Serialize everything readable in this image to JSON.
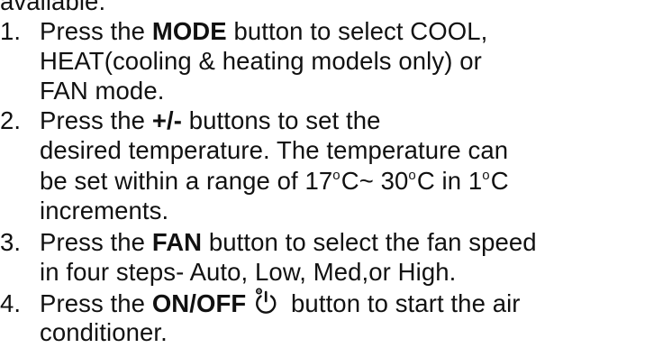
{
  "doc": {
    "top_fragment": "available:",
    "steps": [
      {
        "number": "1.",
        "lines": [
          {
            "before": "Press the ",
            "bold": "MODE",
            "after": " button to select COOL,"
          },
          {
            "text": "HEAT(cooling & heating models only) or"
          },
          {
            "text": "FAN mode."
          }
        ]
      },
      {
        "number": "2.",
        "lines": [
          {
            "before": "Press  the ",
            "bold": "+/-",
            "after": " buttons to set the"
          },
          {
            "text": "desired temperature. The temperature can"
          },
          {
            "t1": "be set within a range of 17",
            "deg": "o",
            "t2": "C~ 30",
            "t3": "C in 1",
            "t4": "C"
          },
          {
            "text": "increments."
          }
        ]
      },
      {
        "number": "3.",
        "lines": [
          {
            "before": "Press the ",
            "bold": "FAN",
            "after": " button to select the fan speed"
          },
          {
            "text": "in four steps- Auto, Low, Med,or High."
          }
        ]
      },
      {
        "number": "4.",
        "lines": [
          {
            "before": "Press the ",
            "bold": "ON/OFF",
            "after": " button to start the air",
            "icon": "power-icon"
          },
          {
            "text": "conditioner."
          }
        ]
      }
    ]
  }
}
